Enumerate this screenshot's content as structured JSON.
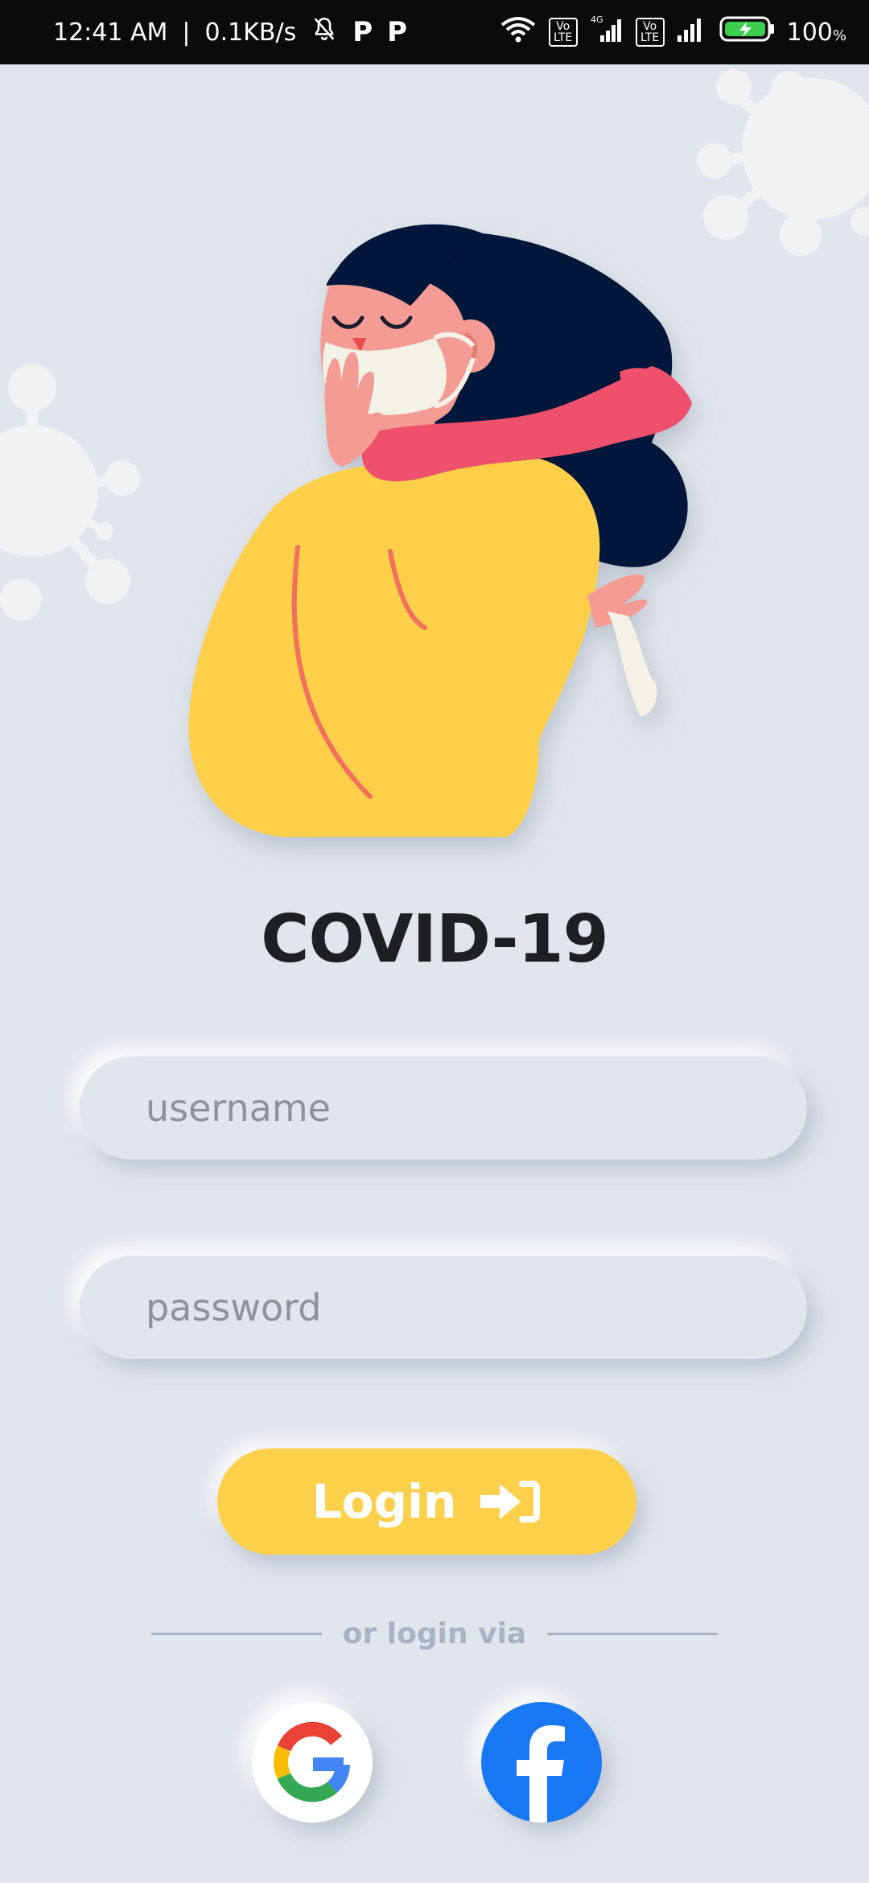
{
  "status_bar": {
    "time": "12:41 AM",
    "network_speed": "0.1KB/s",
    "battery_percent": "100",
    "battery_unit": "%",
    "network_tech": "4G",
    "volte_label": "Vo LTE",
    "notification_icons": [
      "bell-off-icon",
      "parking-icon",
      "parking-icon"
    ]
  },
  "app": {
    "title": "COVID-19"
  },
  "form": {
    "username_placeholder": "username",
    "password_placeholder": "password",
    "login_label": "Login"
  },
  "alt_login": {
    "divider_text": "or login via",
    "providers": [
      "google",
      "facebook"
    ]
  },
  "colors": {
    "background": "#e1e5ec",
    "accent_yellow": "#fdd04b",
    "facebook_blue": "#1877f2",
    "title_dark": "#1e1f22"
  }
}
